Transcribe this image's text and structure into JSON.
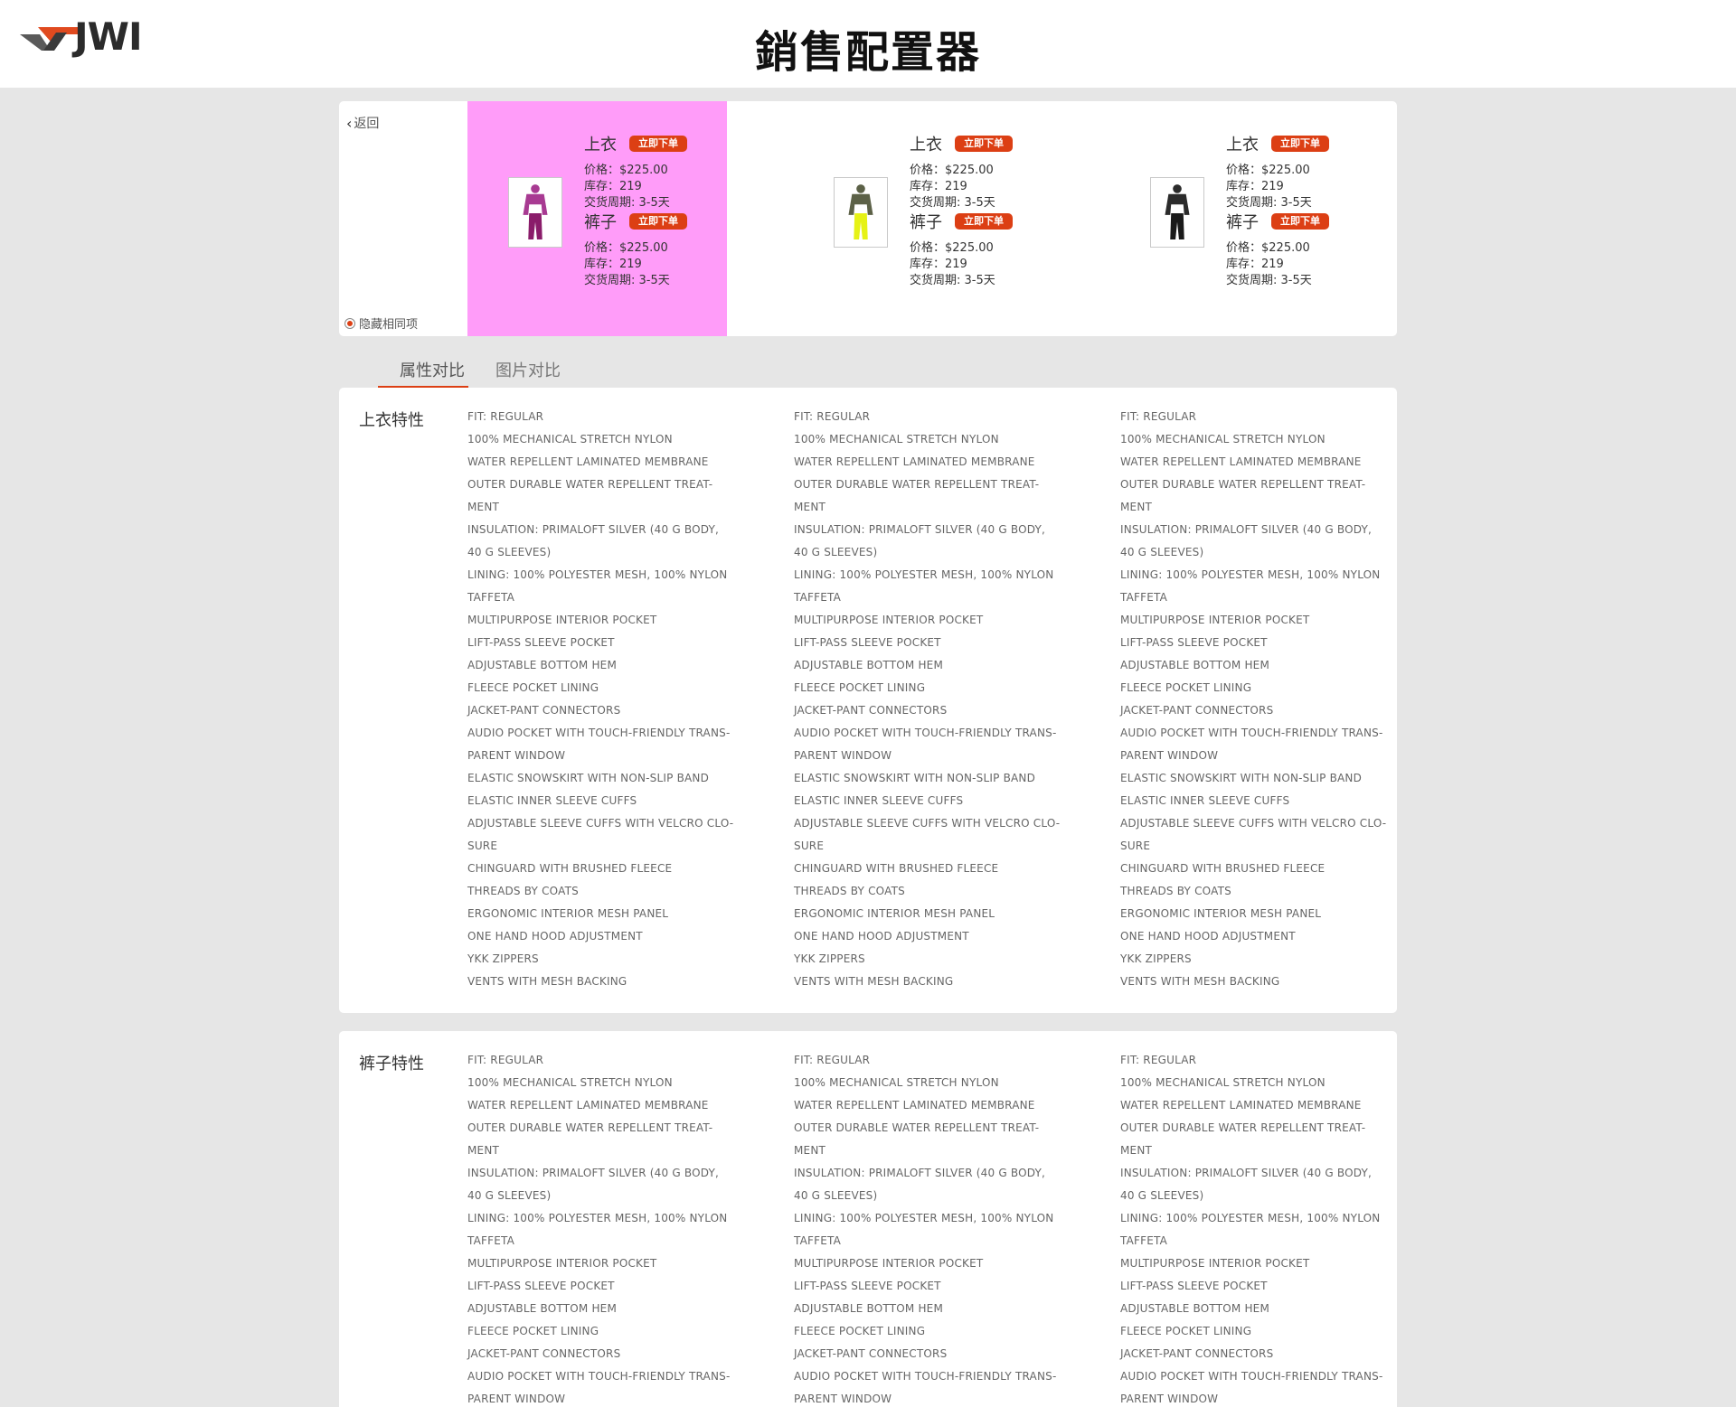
{
  "header": {
    "logo_text": "JWI",
    "title": "銷售配置器"
  },
  "controls": {
    "back_label": "返回",
    "hide_same_label": "隐藏相同项"
  },
  "products": [
    {
      "highlighted": true,
      "figure_colors": {
        "top": "#a83a92",
        "bottom": "#8a1c6a"
      },
      "items": [
        {
          "name": "上衣",
          "order_label": "立即下单",
          "price_label": "价格：",
          "price": "$225.00",
          "stock_label": "库存：",
          "stock": "219",
          "lead_label": "交货周期:",
          "lead": "3-5天"
        },
        {
          "name": "裤子",
          "order_label": "立即下单",
          "price_label": "价格：",
          "price": "$225.00",
          "stock_label": "库存：",
          "stock": "219",
          "lead_label": "交货周期:",
          "lead": "3-5天"
        }
      ]
    },
    {
      "highlighted": false,
      "figure_colors": {
        "top": "#5c6147",
        "bottom": "#e6f216"
      },
      "items": [
        {
          "name": "上衣",
          "order_label": "立即下单",
          "price_label": "价格：",
          "price": "$225.00",
          "stock_label": "库存：",
          "stock": "219",
          "lead_label": "交货周期:",
          "lead": "3-5天"
        },
        {
          "name": "裤子",
          "order_label": "立即下单",
          "price_label": "价格：",
          "price": "$225.00",
          "stock_label": "库存：",
          "stock": "219",
          "lead_label": "交货周期:",
          "lead": "3-5天"
        }
      ]
    },
    {
      "highlighted": false,
      "figure_colors": {
        "top": "#2b2b2b",
        "bottom": "#1a1a1a"
      },
      "items": [
        {
          "name": "上衣",
          "order_label": "立即下单",
          "price_label": "价格：",
          "price": "$225.00",
          "stock_label": "库存：",
          "stock": "219",
          "lead_label": "交货周期:",
          "lead": "3-5天"
        },
        {
          "name": "裤子",
          "order_label": "立即下单",
          "price_label": "价格：",
          "price": "$225.00",
          "stock_label": "库存：",
          "stock": "219",
          "lead_label": "交货周期:",
          "lead": "3-5天"
        }
      ]
    }
  ],
  "tabs": [
    {
      "label": "属性对比",
      "active": true
    },
    {
      "label": "图片对比",
      "active": false
    }
  ],
  "sections": [
    {
      "title": "上衣特性",
      "features": [
        "FIT: REGULAR",
        "100% MECHANICAL STRETCH NYLON",
        "WATER REPELLENT LAMINATED MEMBRANE",
        "OUTER DURABLE WATER REPELLENT TREAT-",
        "MENT",
        "INSULATION: PRIMALOFT SILVER (40 G BODY,",
        "40 G SLEEVES)",
        "LINING: 100% POLYESTER MESH, 100% NYLON",
        "TAFFETA",
        "MULTIPURPOSE INTERIOR POCKET",
        "LIFT-PASS SLEEVE POCKET",
        "ADJUSTABLE BOTTOM HEM",
        "FLEECE POCKET LINING",
        "JACKET-PANT CONNECTORS",
        "AUDIO POCKET WITH TOUCH-FRIENDLY TRANS-",
        "PARENT WINDOW",
        "ELASTIC SNOWSKIRT WITH NON-SLIP BAND",
        "ELASTIC INNER SLEEVE CUFFS",
        "ADJUSTABLE SLEEVE CUFFS WITH VELCRO CLO-",
        "SURE",
        "CHINGUARD WITH BRUSHED FLEECE",
        "THREADS BY COATS",
        "ERGONOMIC INTERIOR MESH PANEL",
        "ONE HAND HOOD ADJUSTMENT",
        "YKK ZIPPERS",
        "VENTS WITH MESH BACKING"
      ]
    },
    {
      "title": "裤子特性",
      "features": [
        "FIT: REGULAR",
        "100% MECHANICAL STRETCH NYLON",
        "WATER REPELLENT LAMINATED MEMBRANE",
        "OUTER DURABLE WATER REPELLENT TREAT-",
        "MENT",
        "INSULATION: PRIMALOFT SILVER (40 G BODY,",
        "40 G SLEEVES)",
        "LINING: 100% POLYESTER MESH, 100% NYLON",
        "TAFFETA",
        "MULTIPURPOSE INTERIOR POCKET",
        "LIFT-PASS SLEEVE POCKET",
        "ADJUSTABLE BOTTOM HEM",
        "FLEECE POCKET LINING",
        "JACKET-PANT CONNECTORS",
        "AUDIO POCKET WITH TOUCH-FRIENDLY TRANS-",
        "PARENT WINDOW"
      ]
    }
  ],
  "colors": {
    "accent": "#dc3f14",
    "text": "#666666",
    "background": "#e6e6e6",
    "highlight": "#ff9cf9"
  }
}
